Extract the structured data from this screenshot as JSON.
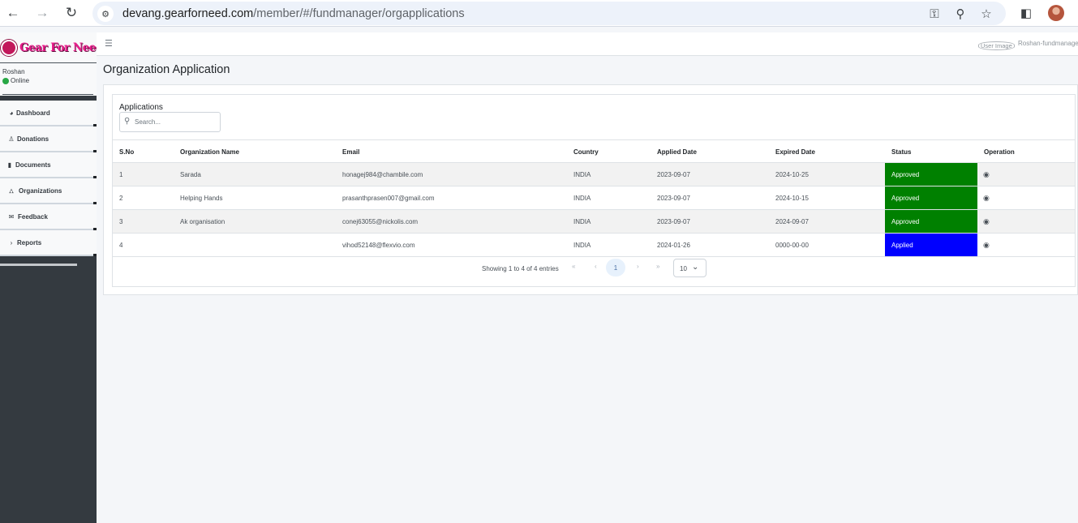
{
  "browser": {
    "url_host": "devang.gearforneed.com",
    "url_path": "/member/#/fundmanager/orgapplications"
  },
  "sidebar": {
    "brand": "Gear For Need",
    "user_name": "Roshan",
    "user_status": "Online",
    "items": [
      {
        "label": "Dashboard",
        "icon": "gauge-icon"
      },
      {
        "label": "Donations",
        "icon": "user-icon"
      },
      {
        "label": "Documents",
        "icon": "file-icon"
      },
      {
        "label": "Organizations",
        "icon": "sitemap-icon"
      },
      {
        "label": "Feedback",
        "icon": "envelope-icon"
      },
      {
        "label": "Reports",
        "icon": "chevron-right-icon"
      }
    ]
  },
  "topnav": {
    "user_image_alt": "User Image",
    "user_name": "Roshan-fundmanage"
  },
  "page": {
    "title": "Organization Application"
  },
  "applications": {
    "title": "Applications",
    "search_placeholder": "Search...",
    "columns": [
      "S.No",
      "Organization Name",
      "Email",
      "Country",
      "Applied Date",
      "Expired Date",
      "Status",
      "Operation"
    ],
    "rows": [
      {
        "sno": "1",
        "org": "Sarada",
        "email": "honagej984@chambile.com",
        "country": "INDIA",
        "applied": "2023-09-07",
        "expired": "2024-10-25",
        "status": "Approved",
        "status_color": "#008000"
      },
      {
        "sno": "2",
        "org": "Helping Hands",
        "email": "prasanthprasen007@gmail.com",
        "country": "INDIA",
        "applied": "2023-09-07",
        "expired": "2024-10-15",
        "status": "Approved",
        "status_color": "#008000"
      },
      {
        "sno": "3",
        "org": "Ak organisation",
        "email": "conej63055@nickolis.com",
        "country": "INDIA",
        "applied": "2023-09-07",
        "expired": "2024-09-07",
        "status": "Approved",
        "status_color": "#008000"
      },
      {
        "sno": "4",
        "org": "",
        "email": "vihod52148@flexvio.com",
        "country": "INDIA",
        "applied": "2024-01-26",
        "expired": "0000-00-00",
        "status": "Applied",
        "status_color": "#0000ff"
      }
    ],
    "entries_info": "Showing 1 to 4 of 4 entries",
    "pagination": {
      "first": "«",
      "prev": "‹",
      "current": "1",
      "next": "›",
      "last": "»"
    },
    "page_size": "10"
  }
}
